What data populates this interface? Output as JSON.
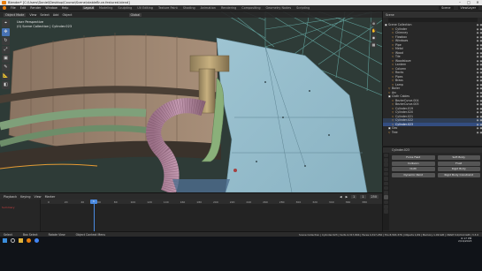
{
  "window": {
    "title": "Blender* [C:\\Users\\Daniel\\Desktop\\Course\\Scene\\stableBr.ce.festured.blend]",
    "controls": [
      "–",
      "□",
      "✕"
    ]
  },
  "menu": [
    "File",
    "Edit",
    "Render",
    "Window",
    "Help"
  ],
  "workspaces": [
    "Layout",
    "Modeling",
    "Sculpting",
    "UV Editing",
    "Texture Paint",
    "Shading",
    "Animation",
    "Rendering",
    "Compositing",
    "Geometry Nodes",
    "Scripting"
  ],
  "active_workspace": "Layout",
  "scene_name": "Scene",
  "view_layer": "ViewLayer",
  "viewport": {
    "mode": "Object Mode",
    "menus": [
      "View",
      "Select",
      "Add",
      "Object"
    ],
    "transform": "Global",
    "info_line1": "User Perspective",
    "info_line2": "(0) Scene Collection | Cylinder.023"
  },
  "toolbar_icons": [
    "cursor-icon",
    "move-icon",
    "rotate-icon",
    "scale-icon",
    "transform-icon",
    "annotate-icon",
    "measure-icon",
    "add-cube-icon"
  ],
  "outliner": {
    "header": "Scene",
    "items": [
      {
        "label": "Scene Collection",
        "depth": 0,
        "kind": "coll",
        "state": ""
      },
      {
        "label": "Cylinder",
        "depth": 2,
        "kind": "obj",
        "state": ""
      },
      {
        "label": "Chimney",
        "depth": 2,
        "kind": "obj",
        "state": ""
      },
      {
        "label": "Flowbox",
        "depth": 2,
        "kind": "obj",
        "state": ""
      },
      {
        "label": "Windows",
        "depth": 2,
        "kind": "obj",
        "state": ""
      },
      {
        "label": "Pipe",
        "depth": 2,
        "kind": "obj",
        "state": ""
      },
      {
        "label": "Metal",
        "depth": 2,
        "kind": "obj",
        "state": ""
      },
      {
        "label": "Wood",
        "depth": 2,
        "kind": "obj",
        "state": ""
      },
      {
        "label": "Tile",
        "depth": 2,
        "kind": "obj",
        "state": ""
      },
      {
        "label": "Woodstove",
        "depth": 2,
        "kind": "obj",
        "state": ""
      },
      {
        "label": "Lantern",
        "depth": 2,
        "kind": "obj",
        "state": ""
      },
      {
        "label": "Column",
        "depth": 2,
        "kind": "obj",
        "state": ""
      },
      {
        "label": "Rocks",
        "depth": 2,
        "kind": "obj",
        "state": ""
      },
      {
        "label": "Pipes",
        "depth": 2,
        "kind": "obj",
        "state": ""
      },
      {
        "label": "Brass",
        "depth": 2,
        "kind": "obj",
        "state": ""
      },
      {
        "label": "Lamp",
        "depth": 2,
        "kind": "obj",
        "state": ""
      },
      {
        "label": "Boiler",
        "depth": 1,
        "kind": "obj",
        "state": ""
      },
      {
        "label": "Arc",
        "depth": 1,
        "kind": "obj",
        "state": ""
      },
      {
        "label": "Cloth Cables",
        "depth": 1,
        "kind": "coll",
        "state": ""
      },
      {
        "label": "BezierCurve.004",
        "depth": 2,
        "kind": "obj",
        "state": ""
      },
      {
        "label": "BezierCurve.005",
        "depth": 2,
        "kind": "obj",
        "state": ""
      },
      {
        "label": "Cylinder.019",
        "depth": 2,
        "kind": "obj",
        "state": ""
      },
      {
        "label": "Cylinder.020",
        "depth": 2,
        "kind": "obj",
        "state": ""
      },
      {
        "label": "Cylinder.021",
        "depth": 2,
        "kind": "obj",
        "state": ""
      },
      {
        "label": "Cylinder.022",
        "depth": 2,
        "kind": "obj",
        "state": "hl"
      },
      {
        "label": "Cylinder.023",
        "depth": 2,
        "kind": "obj",
        "state": "sel"
      },
      {
        "label": "Geo",
        "depth": 1,
        "kind": "coll",
        "state": ""
      },
      {
        "label": "Tree",
        "depth": 1,
        "kind": "obj",
        "state": ""
      }
    ]
  },
  "properties": {
    "object_name": "Cylinder.023",
    "panel_title": "Physics",
    "buttons": [
      [
        "Force Field",
        "Soft Body"
      ],
      [
        "Collision",
        "Fluid"
      ],
      [
        "Cloth",
        "Rigid Body"
      ],
      [
        "Dynamic Paint",
        "Rigid Body Constraint"
      ]
    ]
  },
  "timeline": {
    "menus": [
      "Playback",
      "Keying",
      "View",
      "Marker"
    ],
    "current_frame": "1",
    "start": "1",
    "end": "250",
    "ticks": [
      "0",
      "20",
      "40",
      "60",
      "80",
      "100",
      "120",
      "140",
      "160",
      "180",
      "200",
      "220",
      "240",
      "260",
      "280",
      "300",
      "320",
      "340",
      "360",
      "380"
    ],
    "summary_label": "Summary"
  },
  "statusbar": {
    "left": [
      "Select",
      "Box Select",
      "Rotate View",
      "Object Context Menu"
    ],
    "right": "Scene Collection | Cylinder.023 | Verts 4,317,804 | Faces 4,317,256 | Tris 8,563,376 | Objects 1/29 | Memory 1.09 GiB | VRAM 3.0/24.0 GiB | 3.3.0"
  },
  "taskbar": {
    "time": "6:17 PM",
    "date": "2/16/2023"
  },
  "colors": {
    "accent": "#4772b3",
    "selection": "#334d80",
    "playhead": "#4a8ae0"
  }
}
